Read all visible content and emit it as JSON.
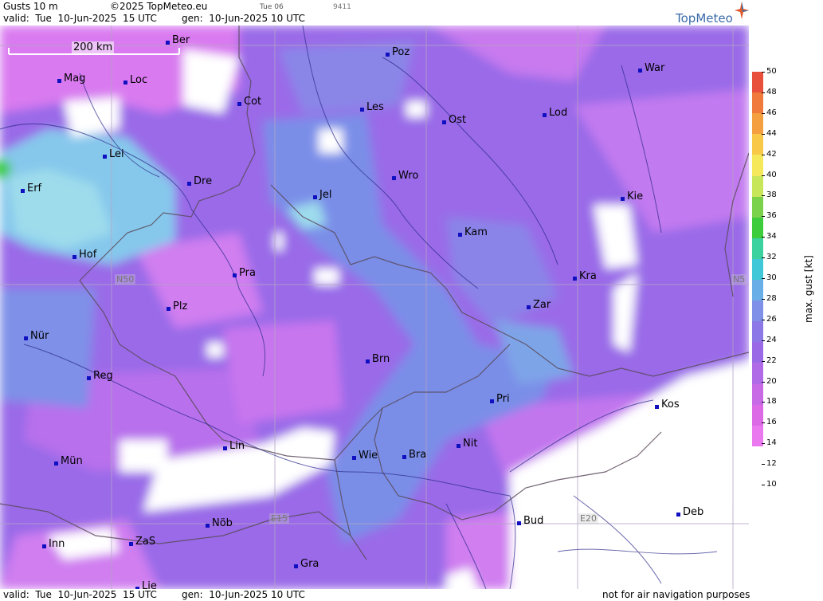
{
  "header": {
    "product": "Gusts 10 m",
    "copyright": "©2025 TopMeteo.eu",
    "valid_line": "valid:  Tue  10-Jun-2025  15 UTC",
    "gen_line": "gen:  10-Jun-2025 10 UTC",
    "small_date": "Tue 06",
    "small_code": "9411",
    "brand": "TopMeteo"
  },
  "footer": {
    "valid_line": "valid:  Tue  10-Jun-2025  15 UTC",
    "gen_line": "gen:  10-Jun-2025 10 UTC",
    "note": "not for air navigation purposes"
  },
  "scale": {
    "label": "200 km"
  },
  "grid_labels": {
    "n50": "N50",
    "n5": "N5",
    "e15": "E15",
    "e20": "E20"
  },
  "cities": [
    {
      "name": "Ber"
    },
    {
      "name": "Poz"
    },
    {
      "name": "Mag"
    },
    {
      "name": "Loc"
    },
    {
      "name": "War"
    },
    {
      "name": "Cot"
    },
    {
      "name": "Les"
    },
    {
      "name": "Lod"
    },
    {
      "name": "Ost"
    },
    {
      "name": "Lei"
    },
    {
      "name": "Erf"
    },
    {
      "name": "Dre"
    },
    {
      "name": "Wro"
    },
    {
      "name": "Jel"
    },
    {
      "name": "Kie"
    },
    {
      "name": "Kam"
    },
    {
      "name": "Hof"
    },
    {
      "name": "Pra"
    },
    {
      "name": "Kra"
    },
    {
      "name": "Zar"
    },
    {
      "name": "Plz"
    },
    {
      "name": "Nür"
    },
    {
      "name": "Brn"
    },
    {
      "name": "Reg"
    },
    {
      "name": "Pri"
    },
    {
      "name": "Kos"
    },
    {
      "name": "Lin"
    },
    {
      "name": "Nit"
    },
    {
      "name": "Wie"
    },
    {
      "name": "Bra"
    },
    {
      "name": "Mün"
    },
    {
      "name": "Deb"
    },
    {
      "name": "Nöb"
    },
    {
      "name": "Bud"
    },
    {
      "name": "Inn"
    },
    {
      "name": "ZaS"
    },
    {
      "name": "Gra"
    },
    {
      "name": "Lie"
    }
  ],
  "legend": {
    "title": "max. gust  [kt]",
    "ticks": [
      "50",
      "48",
      "46",
      "44",
      "42",
      "40",
      "38",
      "36",
      "34",
      "32",
      "30",
      "28",
      "26",
      "24",
      "22",
      "20",
      "18",
      "16",
      "14",
      "12",
      "10"
    ],
    "colors": [
      "#e8503c",
      "#f07a3c",
      "#f5a040",
      "#f8c848",
      "#f5e85a",
      "#c8e65a",
      "#7ad24a",
      "#3ccc3c",
      "#3cd2a0",
      "#40c8d8",
      "#6aaee8",
      "#7f90e8",
      "#8c78e6",
      "#9a6ae6",
      "#b06ae8",
      "#c86ae6",
      "#dc6ae6",
      "#ea78ee",
      "#ffffff"
    ]
  },
  "colors": {
    "base_violet": "#9a6ae8",
    "light_magenta": "#d97af0",
    "blue_band": "#7a8ee8",
    "cyan": "#7ed6e8",
    "white_area": "#ffffff",
    "boundary": "#5a4a5a",
    "river": "#2a2a8a",
    "city_dot": "#1010c0"
  }
}
